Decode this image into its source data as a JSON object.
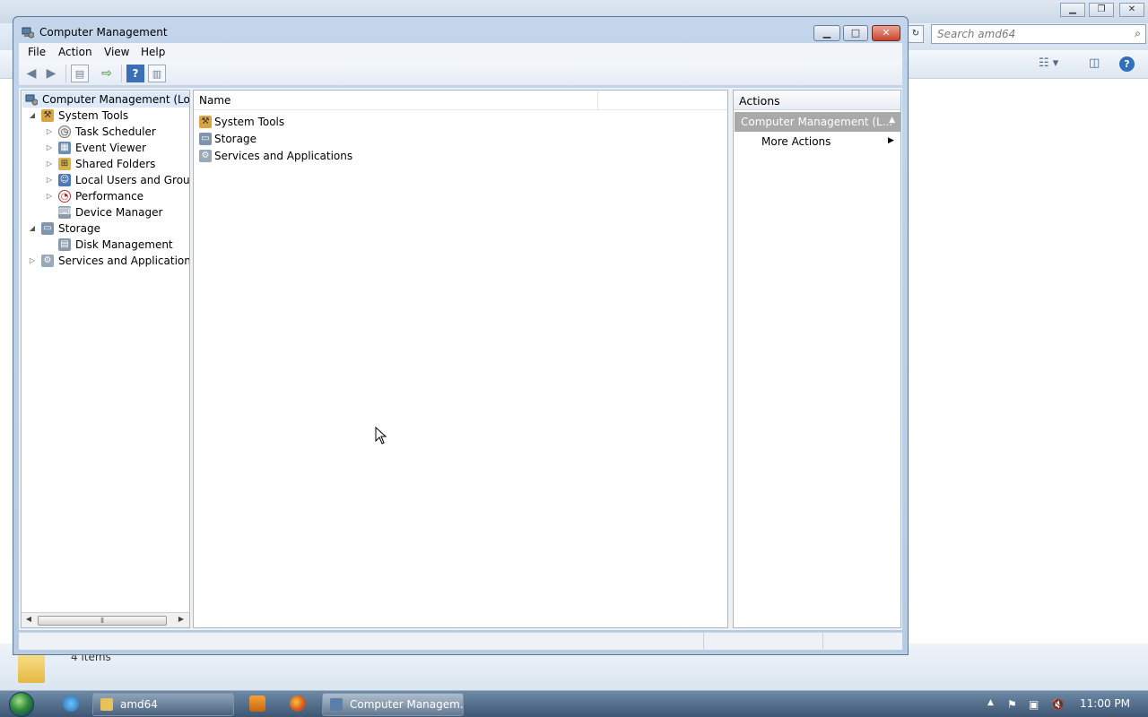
{
  "background_window": {
    "search_placeholder": "Search amd64",
    "status_text": "4 items"
  },
  "window": {
    "title": "Computer Management",
    "menu": [
      "File",
      "Action",
      "View",
      "Help"
    ]
  },
  "tree": {
    "root": "Computer Management (Local",
    "items": [
      {
        "label": "System Tools",
        "level": 1,
        "expander": "expanded"
      },
      {
        "label": "Task Scheduler",
        "level": 2,
        "expander": "collapsed"
      },
      {
        "label": "Event Viewer",
        "level": 2,
        "expander": "collapsed"
      },
      {
        "label": "Shared Folders",
        "level": 2,
        "expander": "collapsed"
      },
      {
        "label": "Local Users and Groups",
        "level": 2,
        "expander": "collapsed"
      },
      {
        "label": "Performance",
        "level": 2,
        "expander": "collapsed"
      },
      {
        "label": "Device Manager",
        "level": 2,
        "expander": "none"
      },
      {
        "label": "Storage",
        "level": 1,
        "expander": "expanded"
      },
      {
        "label": "Disk Management",
        "level": 2,
        "expander": "none"
      },
      {
        "label": "Services and Applications",
        "level": 1,
        "expander": "collapsed"
      }
    ]
  },
  "list": {
    "column_name": "Name",
    "items": [
      "System Tools",
      "Storage",
      "Services and Applications"
    ]
  },
  "actions": {
    "title": "Actions",
    "section": "Computer Management (L...",
    "more_actions": "More Actions"
  },
  "taskbar": {
    "tasks": [
      "amd64",
      "Computer Managem..."
    ],
    "clock": "11:00 PM"
  },
  "colors": {
    "selection": "#dbe9f8",
    "actions_section_bg": "#a9a9a9",
    "title_bar": "#c2d5ea"
  }
}
